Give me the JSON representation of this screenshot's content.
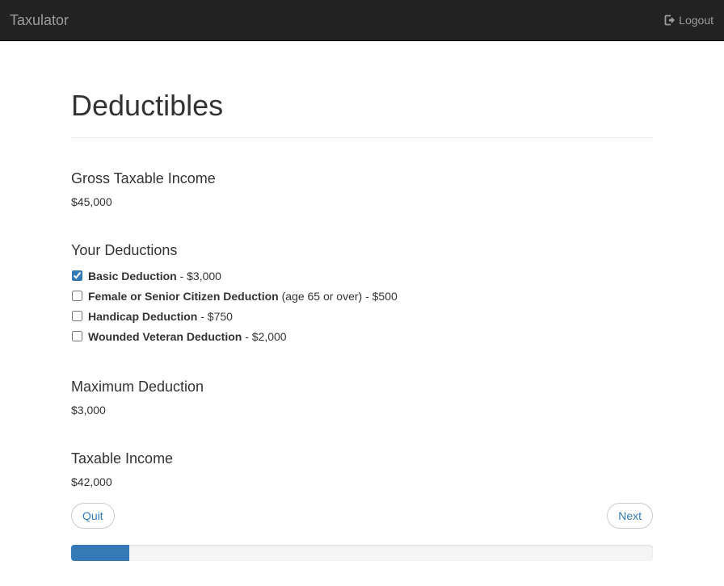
{
  "app": {
    "brand": "Taxulator",
    "logout_label": "Logout"
  },
  "page": {
    "title": "Deductibles"
  },
  "gross": {
    "title": "Gross Taxable Income",
    "value": "$45,000"
  },
  "deductions": {
    "title": "Your Deductions",
    "items": [
      {
        "name": "Basic Deduction",
        "detail": " - $3,000",
        "checked": true
      },
      {
        "name": "Female or Senior Citizen Deduction",
        "detail": " (age 65 or over) - $500",
        "checked": false
      },
      {
        "name": "Handicap Deduction",
        "detail": " - $750",
        "checked": false
      },
      {
        "name": "Wounded Veteran Deduction",
        "detail": " - $2,000",
        "checked": false
      }
    ]
  },
  "maximum": {
    "title": "Maximum Deduction",
    "value": "$3,000"
  },
  "taxable": {
    "title": "Taxable Income",
    "value": "$42,000"
  },
  "buttons": {
    "quit": "Quit",
    "next": "Next"
  },
  "progress": {
    "fraction": 0.1
  },
  "colors": {
    "accent": "#337ab7",
    "navbar": "#222222"
  }
}
